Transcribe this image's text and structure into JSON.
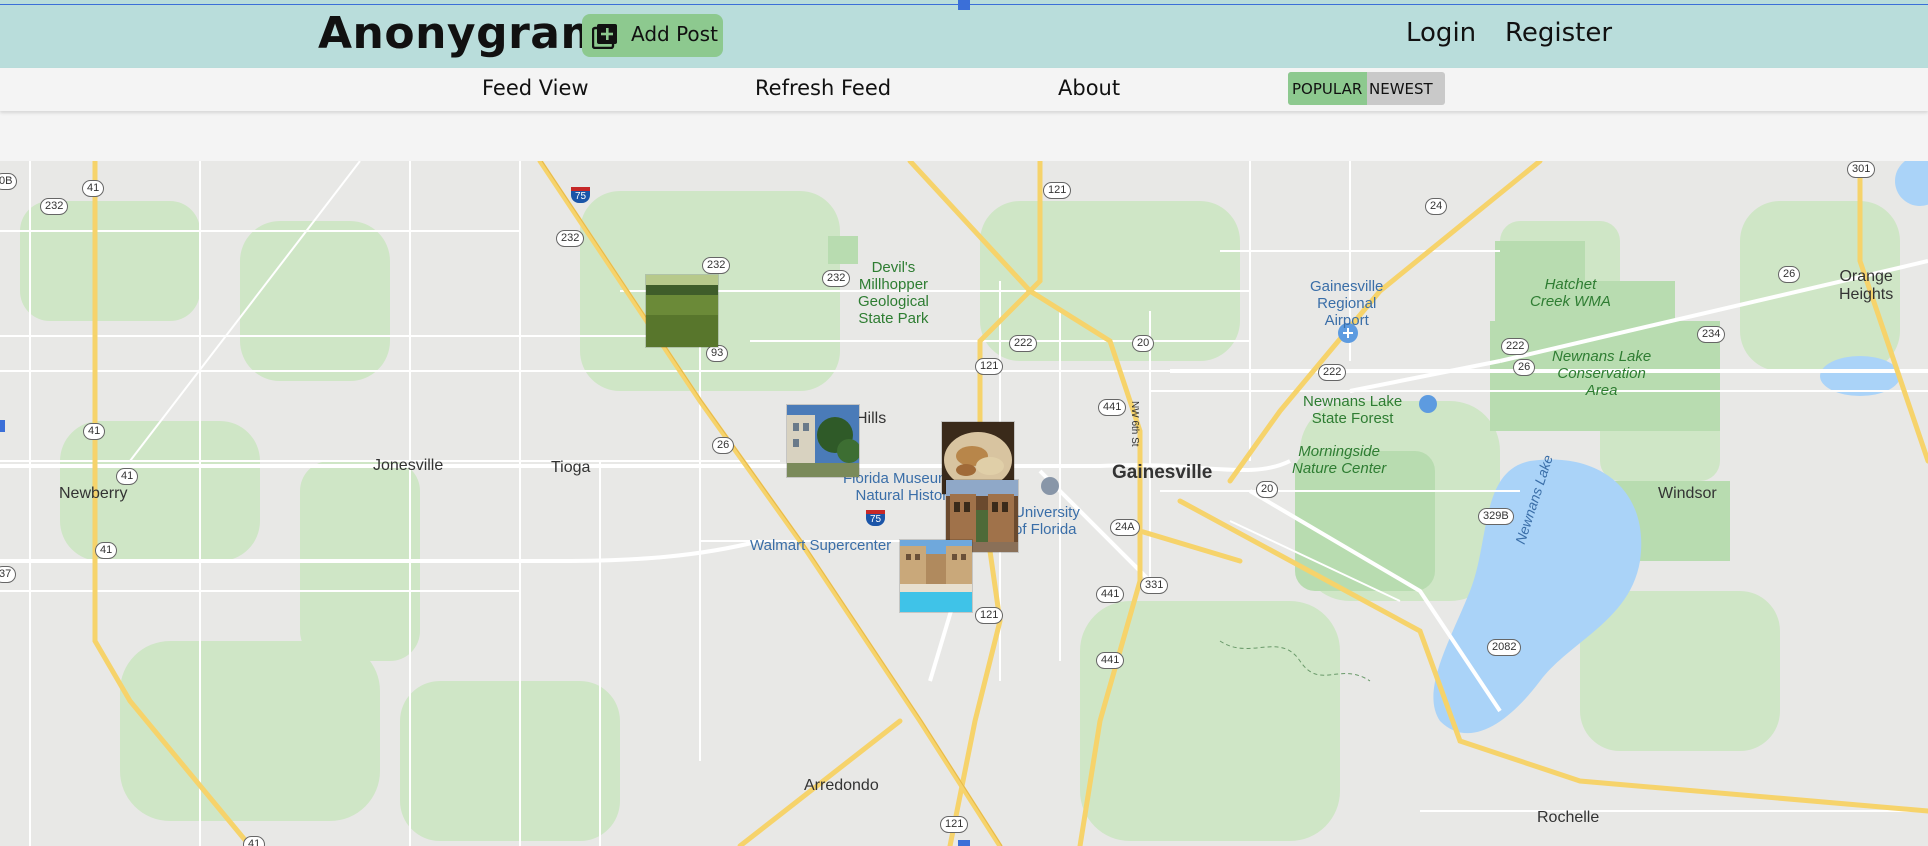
{
  "header": {
    "brand": "Anonygram",
    "add_post_label": "Add Post",
    "login_label": "Login",
    "register_label": "Register"
  },
  "nav": {
    "feed_view": "Feed View",
    "refresh_feed": "Refresh Feed",
    "about": "About",
    "sort_popular": "POPULAR",
    "sort_newest": "NEWEST",
    "active_sort": "POPULAR"
  },
  "colors": {
    "header_bg": "#b9dddb",
    "accent_green": "#8dc98f",
    "toggle_inactive": "#c9c9c9"
  },
  "map": {
    "places": {
      "gainesville": "Gainesville",
      "jonesville": "Jonesville",
      "tioga": "Tioga",
      "newberry": "Newberry",
      "arredondo": "Arredondo",
      "windsor": "Windsor",
      "rochelle": "Rochelle",
      "orange_heights": "Orange\nHeights",
      "hills": "Hills"
    },
    "parks": {
      "devils_millhopper": "Devil's\nMillhopper\nGeological\nState Park",
      "hatchet_creek": "Hatchet\nCreek WMA",
      "newnans_conservation": "Newnans Lake\nConservation\nArea",
      "newnans_forest": "Newnans Lake\nState Forest",
      "morningside": "Morningside\nNature Center"
    },
    "pois": {
      "airport": "Gainesville\nRegional\nAirport",
      "museum": "Florida Museum of\nNatural History",
      "uf": "University\nof Florida",
      "walmart": "Walmart Supercenter"
    },
    "water": {
      "newnans_lake": "Newnans Lake"
    },
    "street": "NW 6th St",
    "shields": [
      "41",
      "232",
      "232",
      "232",
      "232",
      "121",
      "24",
      "26",
      "234",
      "222",
      "222",
      "222",
      "20",
      "20",
      "121",
      "93",
      "26",
      "441",
      "26",
      "441",
      "331",
      "121",
      "441",
      "121",
      "41",
      "41",
      "41",
      "41",
      "20",
      "2082",
      "329B",
      "24A",
      "301",
      "37",
      "0B"
    ],
    "interstate_shields": [
      "75",
      "75"
    ]
  },
  "photos": [
    "grass-field-photo",
    "building-trees-photo",
    "food-photo",
    "courtyard-photo",
    "pool-photo"
  ]
}
